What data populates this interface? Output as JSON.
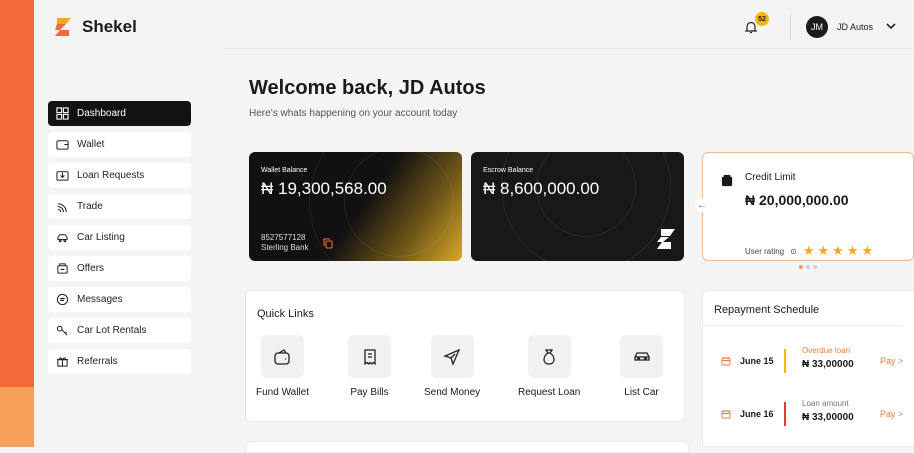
{
  "brand": {
    "name": "Shekel",
    "accent": "#f26a3a"
  },
  "nav": {
    "items": [
      {
        "label": "Dashboard",
        "icon": "grid-icon",
        "active": true
      },
      {
        "label": "Wallet",
        "icon": "wallet-icon"
      },
      {
        "label": "Loan Requests",
        "icon": "inbox-icon"
      },
      {
        "label": "Trade",
        "icon": "signal-icon"
      },
      {
        "label": "Car Listing",
        "icon": "car-icon"
      },
      {
        "label": "Offers",
        "icon": "offers-icon"
      },
      {
        "label": "Messages",
        "icon": "message-icon"
      },
      {
        "label": "Car Lot Rentals",
        "icon": "key-icon"
      },
      {
        "label": "Referrals",
        "icon": "gift-icon"
      }
    ]
  },
  "header": {
    "notification_count": "52",
    "avatar_initials": "JM",
    "user_name": "JD Autos"
  },
  "welcome": {
    "title": "Welcome back, JD Autos",
    "subtitle": "Here’s whats happening on your account today"
  },
  "wallet_card": {
    "label": "Wallet Balance",
    "amount": "₦ 19,300,568.00",
    "account_number": "8527577128",
    "bank": "Sterling Bank"
  },
  "escrow_card": {
    "label": "Escrow Balance",
    "amount": "₦ 8,600,000.00"
  },
  "credit_card": {
    "title": "Credit Limit",
    "amount": "₦ 20,000,000.00",
    "rating_label": "User rating",
    "stars": 5
  },
  "quick_links": {
    "title": "Quick Links",
    "items": [
      {
        "label": "Fund Wallet",
        "icon": "wallet-icon"
      },
      {
        "label": "Pay Bills",
        "icon": "receipt-icon"
      },
      {
        "label": "Send Money",
        "icon": "send-icon"
      },
      {
        "label": "Request Loan",
        "icon": "money-bag-icon"
      },
      {
        "label": "List Car",
        "icon": "car-icon"
      }
    ]
  },
  "repayment": {
    "title": "Repayment Schedule",
    "rows": [
      {
        "date": "June 15",
        "kind": "Overdue loan",
        "amount": "₦ 33,00000",
        "pay": "Pay >",
        "kind_color": "#f07a3c",
        "bar_color": "#f5b700"
      },
      {
        "date": "June 16",
        "kind": "Loan amount",
        "amount": "₦ 33,00000",
        "pay": "Pay >",
        "kind_color": "#777777",
        "bar_color": "#e53935"
      }
    ]
  }
}
